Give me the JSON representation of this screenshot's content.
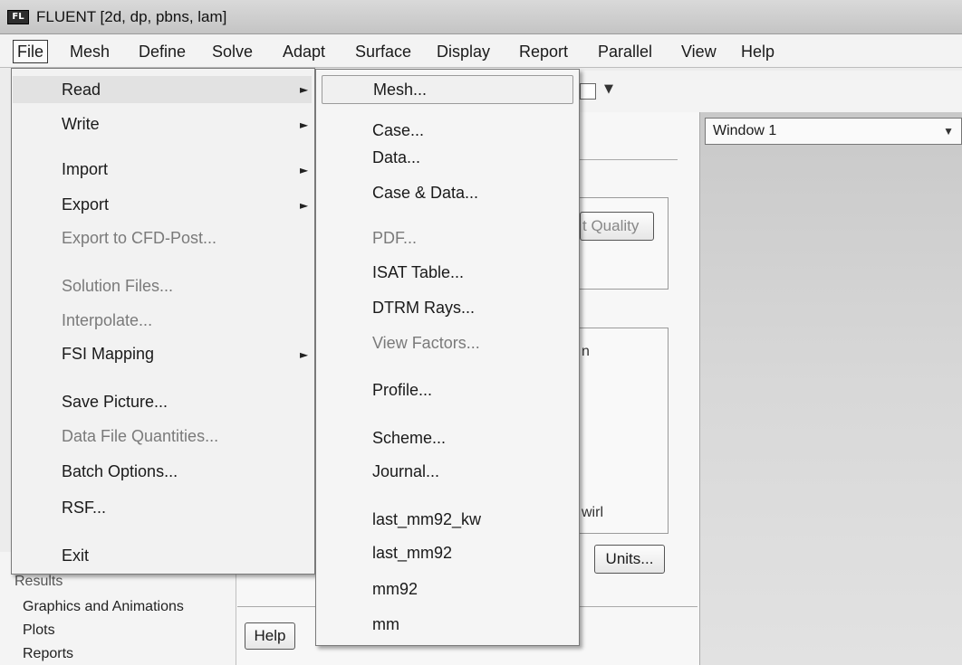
{
  "window": {
    "icon_label": "FL",
    "title": "FLUENT  [2d, dp, pbns, lam]"
  },
  "menubar": [
    {
      "label": "File"
    },
    {
      "label": "Mesh"
    },
    {
      "label": "Define"
    },
    {
      "label": "Solve"
    },
    {
      "label": "Adapt"
    },
    {
      "label": "Surface"
    },
    {
      "label": "Display"
    },
    {
      "label": "Report"
    },
    {
      "label": "Parallel"
    },
    {
      "label": "View"
    },
    {
      "label": "Help"
    }
  ],
  "file_menu": [
    {
      "label": "Read",
      "submenu": true
    },
    {
      "label": "Write",
      "submenu": true
    },
    {
      "label": "Import",
      "submenu": true
    },
    {
      "label": "Export",
      "submenu": true
    },
    {
      "label": "Export to CFD-Post...",
      "disabled": true
    },
    {
      "label": "Solution Files...",
      "disabled": true
    },
    {
      "label": "Interpolate...",
      "disabled": true
    },
    {
      "label": "FSI Mapping",
      "submenu": true
    },
    {
      "label": "Save Picture..."
    },
    {
      "label": "Data File Quantities...",
      "disabled": true
    },
    {
      "label": "Batch Options..."
    },
    {
      "label": "RSF..."
    },
    {
      "label": "Exit"
    }
  ],
  "read_submenu": [
    {
      "label": "Mesh..."
    },
    {
      "label": "Case..."
    },
    {
      "label": "Data..."
    },
    {
      "label": "Case & Data..."
    },
    {
      "label": "PDF...",
      "disabled": true
    },
    {
      "label": "ISAT Table..."
    },
    {
      "label": "DTRM Rays..."
    },
    {
      "label": "View Factors...",
      "disabled": true
    },
    {
      "label": "Profile..."
    },
    {
      "label": "Scheme..."
    },
    {
      "label": "Journal..."
    },
    {
      "label": "last_mm92_kw"
    },
    {
      "label": "last_mm92"
    },
    {
      "label": "mm92"
    },
    {
      "label": "mm"
    }
  ],
  "panel": {
    "quality_button": "t Quality",
    "partial_text_1": "n",
    "partial_text_2": "wirl",
    "units_button": "Units...",
    "help_button": "Help"
  },
  "tree": {
    "results_label": "Results",
    "items": [
      "Graphics and Animations",
      "Plots",
      "Reports"
    ]
  },
  "graphics": {
    "window_select": "Window 1"
  }
}
